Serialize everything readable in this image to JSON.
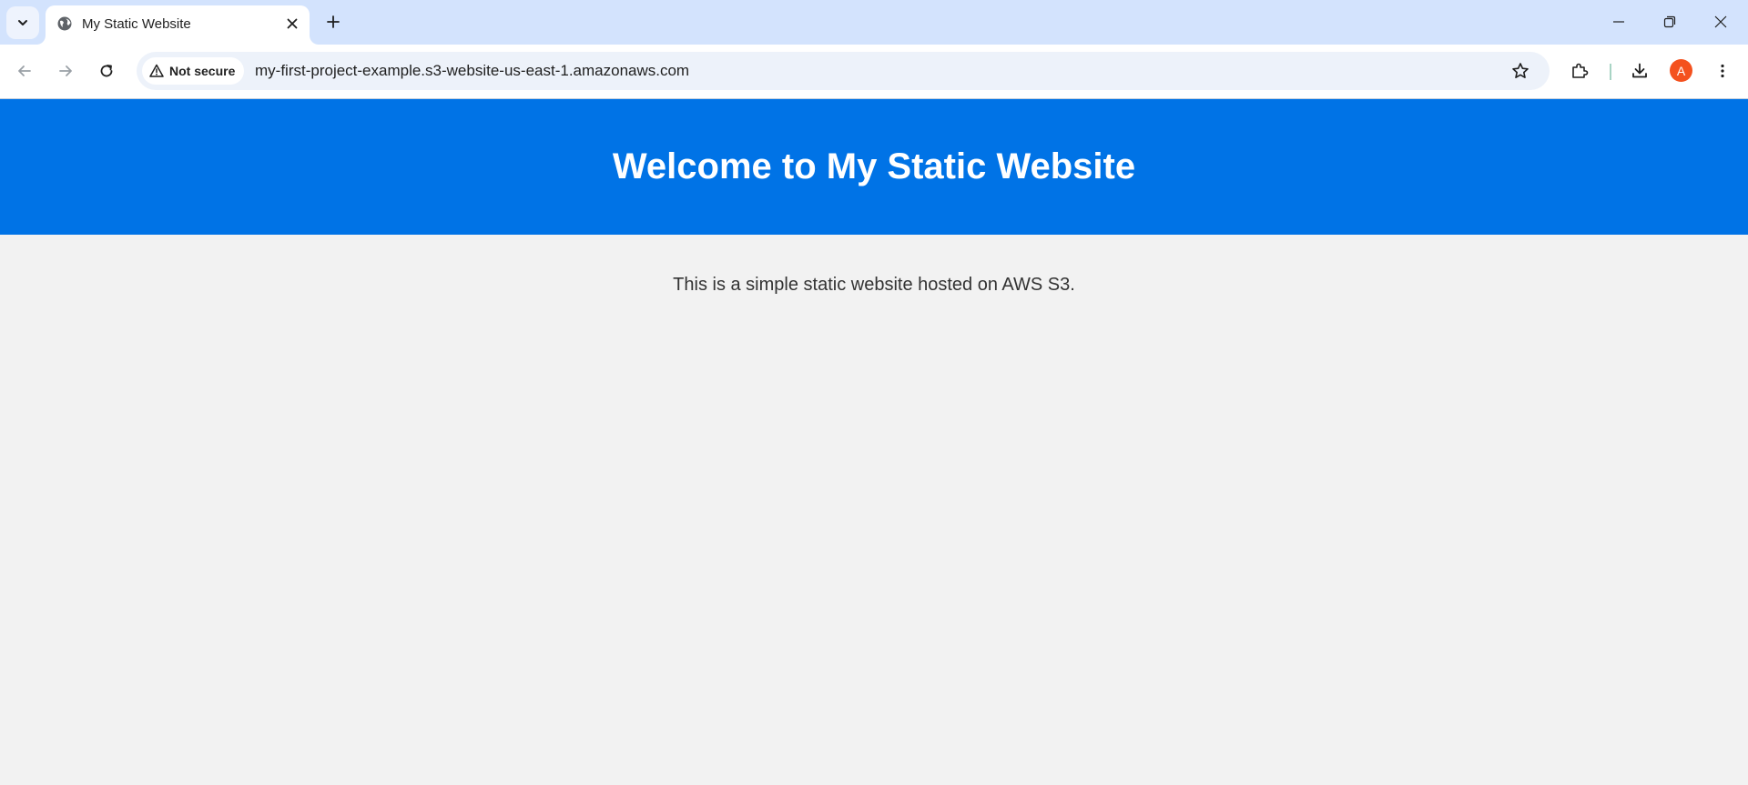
{
  "browser": {
    "tab": {
      "title": "My Static Website",
      "favicon": "globe-icon"
    },
    "security_label": "Not secure",
    "url": "my-first-project-example.s3-website-us-east-1.amazonaws.com",
    "profile_initial": "A",
    "colors": {
      "tabstrip": "#d3e3fd",
      "omnibox": "#edf2fa",
      "avatar": "#f4511e"
    }
  },
  "page": {
    "heading": "Welcome to My Static Website",
    "body_text": "This is a simple static website hosted on AWS S3.",
    "colors": {
      "header_bg": "#0073e6",
      "body_bg": "#f2f2f2"
    }
  }
}
